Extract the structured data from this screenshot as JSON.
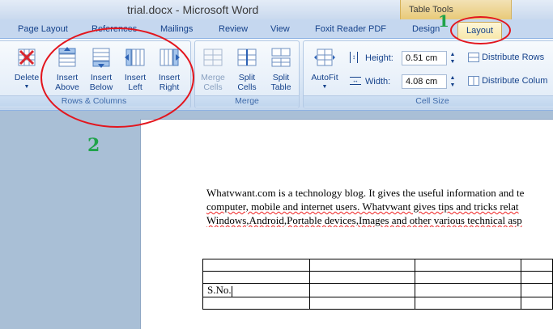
{
  "window": {
    "title": "trial.docx - Microsoft Word"
  },
  "contextual_tab_group": "Table Tools",
  "tabs": [
    "Page Layout",
    "References",
    "Mailings",
    "Review",
    "View",
    "Foxit Reader PDF",
    "Design",
    "Layout"
  ],
  "active_tab": "Layout",
  "ribbon": {
    "rows_columns": {
      "label": "Rows & Columns",
      "delete_label": "Delete",
      "insert_above": [
        "Insert",
        "Above"
      ],
      "insert_below": [
        "Insert",
        "Below"
      ],
      "insert_left": [
        "Insert",
        "Left"
      ],
      "insert_right": [
        "Insert",
        "Right"
      ]
    },
    "merge": {
      "label": "Merge",
      "merge_cells": [
        "Merge",
        "Cells"
      ],
      "split_cells": [
        "Split",
        "Cells"
      ],
      "split_table": [
        "Split",
        "Table"
      ]
    },
    "cell_size": {
      "label": "Cell Size",
      "autofit_label": "AutoFit",
      "height_label": "Height:",
      "height_value": "0.51 cm",
      "width_label": "Width:",
      "width_value": "4.08 cm",
      "distribute_rows": "Distribute Rows",
      "distribute_columns": "Distribute Colum"
    }
  },
  "document": {
    "paragraph_lines": [
      "Whatvwant.com is a technology blog. It gives the useful information and te",
      "computer, mobile and internet users. Whatvwant gives tips and tricks relat",
      "Windows,Android,Portable devices,Images and other various technical asp"
    ],
    "table_cell_text": "S.No."
  },
  "annotations": {
    "marker_1": "1",
    "marker_2": "2"
  },
  "colors": {
    "annotation_red": "#e3161e",
    "annotation_green": "#20a34a"
  }
}
